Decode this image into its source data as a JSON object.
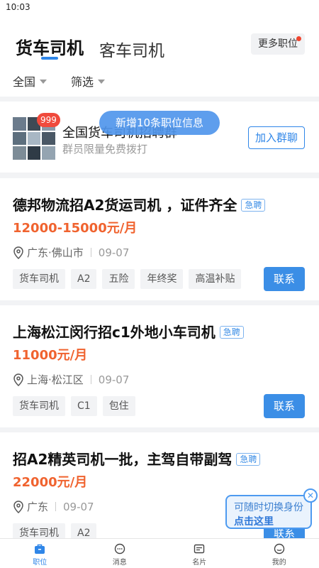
{
  "status_bar": {
    "time": "10:03"
  },
  "header": {
    "tab_active": "货车司机",
    "tab_inactive": "客车司机",
    "more_button": "更多职位"
  },
  "filters": {
    "region": "全国",
    "filter": "筛选"
  },
  "toast": "新增10条职位信息",
  "group": {
    "badge": "999",
    "title": "全国货车司机招聘群",
    "subtitle": "群员限量免费拨打",
    "join_button": "加入群聊"
  },
  "jobs": [
    {
      "title": "德邦物流招A2货运司机 ，证件齐全",
      "urgent": "急聘",
      "salary": "12000-15000元/月",
      "location": "广东·佛山市",
      "date": "09-07",
      "tags": [
        "货车司机",
        "A2",
        "五险",
        "年终奖",
        "高温补贴"
      ],
      "contact": "联系"
    },
    {
      "title": "上海松江闵行招c1外地小车司机",
      "urgent": "急聘",
      "salary": "11000元/月",
      "location": "上海·松江区",
      "date": "09-07",
      "tags": [
        "货车司机",
        "C1",
        "包住"
      ],
      "contact": "联系"
    },
    {
      "title": "招A2精英司机一批，主驾自带副驾",
      "urgent": "急聘",
      "salary": "22000元/月",
      "location": "广东",
      "date": "09-07",
      "tags": [
        "货车司机",
        "A2"
      ],
      "contact": "联系"
    }
  ],
  "float_tip": {
    "line1": "可随时切换身份",
    "line2": "点击这里"
  },
  "bottom_nav": [
    {
      "label": "职位",
      "icon": "briefcase-icon"
    },
    {
      "label": "消息",
      "icon": "chat-icon"
    },
    {
      "label": "名片",
      "icon": "card-icon"
    },
    {
      "label": "我的",
      "icon": "smile-icon"
    }
  ],
  "colors": {
    "accent": "#2f86e8",
    "salary": "#f0632f",
    "badge": "#f04a3c"
  }
}
